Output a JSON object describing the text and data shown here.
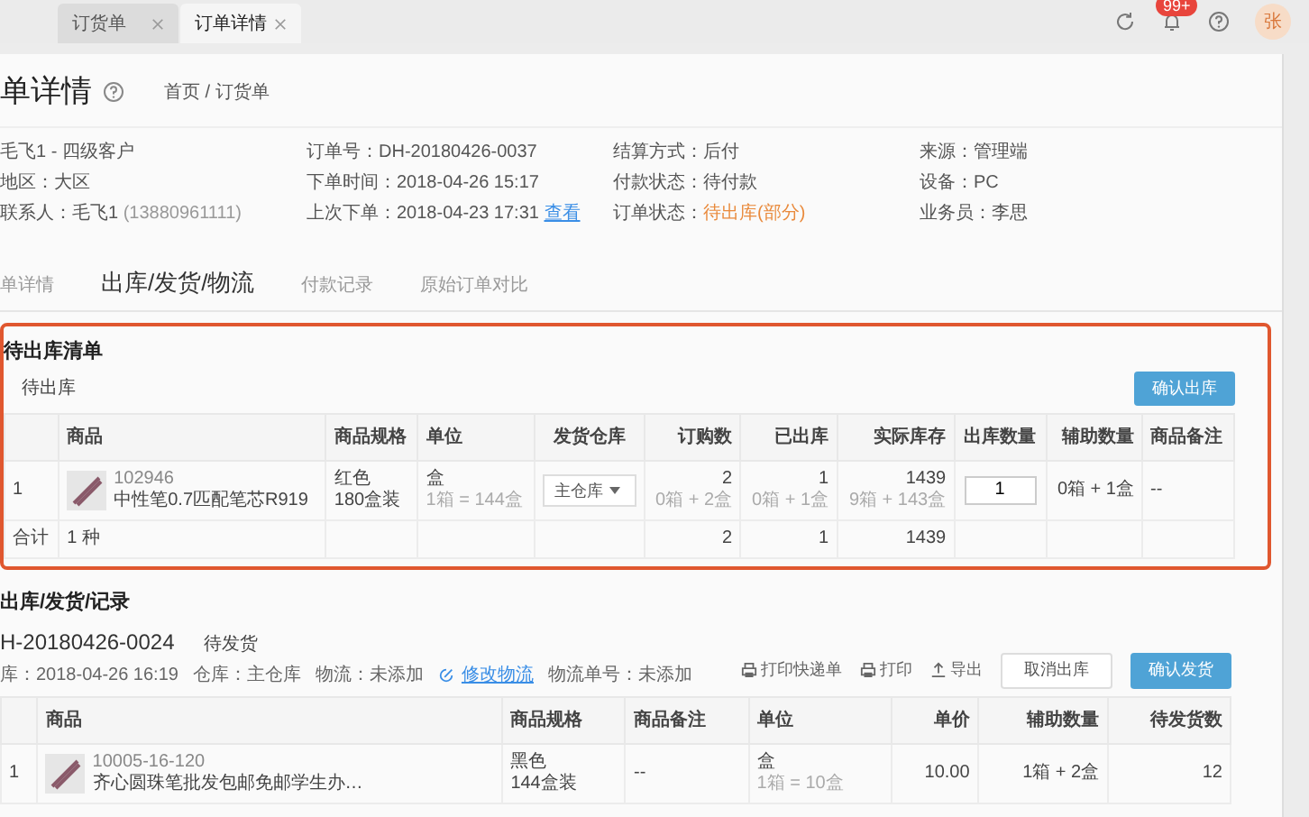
{
  "browser_tabs": [
    {
      "label": "订货单",
      "selected": false
    },
    {
      "label": "订单详情",
      "selected": true
    }
  ],
  "toolbar": {
    "notification_badge": "99+",
    "avatar": "张"
  },
  "page": {
    "title": "单详情",
    "breadcrumb": "首页 / 订货单"
  },
  "info": [
    [
      {
        "value": "毛飞1 - 四级客户",
        "highlight": false
      },
      {
        "label": "地区：",
        "value": "大区",
        "highlight": false
      },
      {
        "label": "联系人：",
        "value": "毛飞1",
        "note": "(13880961111)",
        "highlight": false
      }
    ],
    [
      {
        "label": "订单号：",
        "value": "DH-20180426-0037",
        "highlight": false
      },
      {
        "label": "下单时间：",
        "value": "2018-04-26 15:17",
        "highlight": false
      },
      {
        "label": "上次下单：",
        "value": "2018-04-23 17:31",
        "link": "查看",
        "highlight": false
      }
    ],
    [
      {
        "label": "结算方式：",
        "value": "后付",
        "highlight": false
      },
      {
        "label": "付款状态：",
        "value": "待付款",
        "highlight": false
      },
      {
        "label": "订单状态：",
        "value": "待出库(部分)",
        "highlight": true
      }
    ],
    [
      {
        "label": "来源：",
        "value": "管理端",
        "highlight": false
      },
      {
        "label": "设备：",
        "value": "PC",
        "highlight": false
      },
      {
        "label": "业务员：",
        "value": "李思",
        "highlight": false
      }
    ]
  ],
  "section_tabs": [
    {
      "label": "单详情",
      "selected": false
    },
    {
      "label": "出库/发货/物流",
      "selected": true
    },
    {
      "label": "付款记录",
      "selected": false
    },
    {
      "label": "原始订单对比",
      "selected": false
    }
  ],
  "pending": {
    "title": "待出库清单",
    "subtitle": "待出库",
    "button": "确认出库",
    "columns": [
      "",
      "商品",
      "商品规格",
      "单位",
      "发货仓库",
      "订购数",
      "已出库",
      "实际库存",
      "出库数量",
      "辅助数量",
      "商品备注"
    ],
    "rows": [
      {
        "index": "1",
        "code": "102946",
        "name": "中性笔0.7匹配笔芯R919",
        "spec": [
          "红色",
          "180盒装"
        ],
        "unit": "盒",
        "unit_note": "1箱 = 144盒",
        "warehouse": "主仓库",
        "ordered": "2",
        "ordered_note": "0箱 + 2盒",
        "shipped": "1",
        "shipped_note": "0箱 + 1盒",
        "stock": "1439",
        "stock_note": "9箱 + 143盒",
        "qty": "1",
        "aux": "0箱 + 1盒",
        "remark": "--"
      }
    ],
    "total": {
      "label": "合计",
      "count": "1 种",
      "ordered": "2",
      "shipped": "1",
      "stock": "1439"
    }
  },
  "records": {
    "title": "出库/发货/记录",
    "order_no": "H-20180426-0024",
    "status": "待发货",
    "meta": [
      {
        "kind": "text",
        "text": "库：2018-04-26 16:19"
      },
      {
        "kind": "text",
        "text": "仓库：主仓库"
      },
      {
        "kind": "text",
        "text": "物流：未添加"
      },
      {
        "kind": "link",
        "text": "修改物流"
      },
      {
        "kind": "text",
        "text": "物流单号：未添加"
      }
    ],
    "actions": [
      {
        "kind": "print",
        "label": "打印快递单"
      },
      {
        "kind": "print",
        "label": "打印"
      },
      {
        "kind": "export",
        "label": "导出"
      }
    ],
    "cancel_button": "取消出库",
    "confirm_button": "确认发货",
    "columns": [
      "",
      "商品",
      "商品规格",
      "商品备注",
      "单位",
      "单价",
      "辅助数量",
      "待发货数"
    ],
    "rows": [
      {
        "index": "1",
        "code": "10005-16-120",
        "name": "齐心圆珠笔批发包邮免邮学生办…",
        "spec": [
          "黑色",
          "144盒装"
        ],
        "remark": "--",
        "unit": "盒",
        "unit_note": "1箱 = 10盒",
        "price": "10.00",
        "aux": "1箱 + 2盒",
        "pending": "12"
      }
    ]
  }
}
